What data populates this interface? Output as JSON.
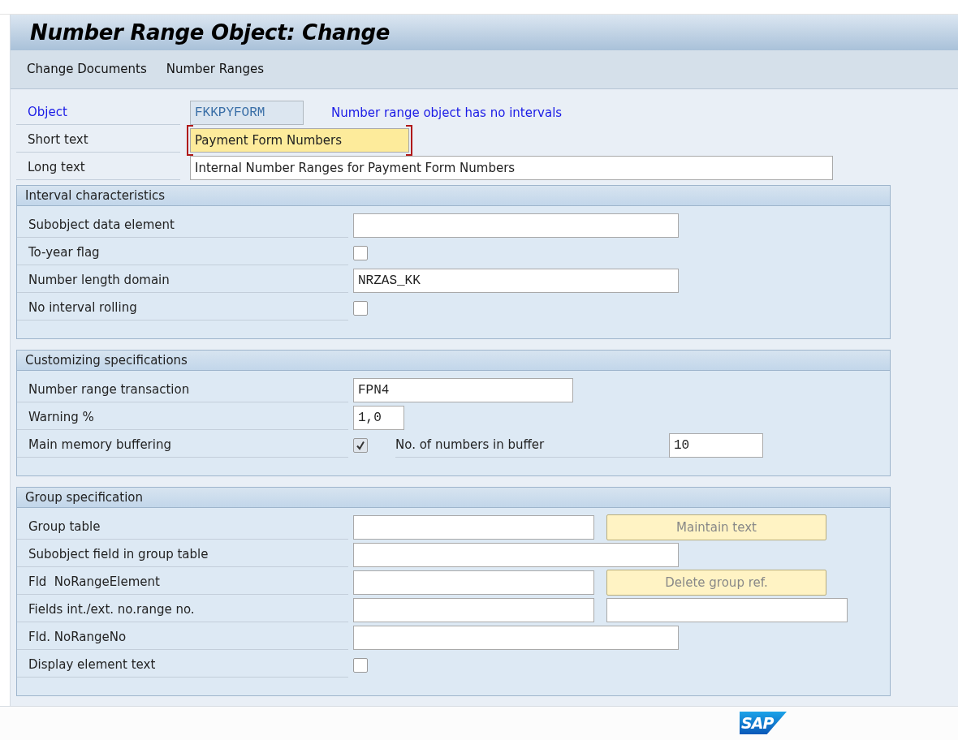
{
  "window": {
    "title": "Number Range Object: Change"
  },
  "toolbar": [
    {
      "label": "Change Documents"
    },
    {
      "label": "Number Ranges"
    }
  ],
  "header": {
    "object": {
      "label": "Object",
      "value": "FKKPYFORM",
      "message": "Number range object has no intervals"
    },
    "short_text": {
      "label": "Short text",
      "value": "Payment Form Numbers",
      "focused": true
    },
    "long_text": {
      "label": "Long text",
      "value": "Internal Number Ranges for Payment Form Numbers"
    }
  },
  "groups": [
    {
      "title": "Interval characteristics",
      "rows": [
        {
          "kind": "field",
          "label": "Subobject data element"
        },
        {
          "kind": "checkbox",
          "label": "To-year flag",
          "checked": false
        },
        {
          "kind": "field",
          "label": "Number length domain",
          "value": "NRZAS_KK"
        },
        {
          "kind": "checkbox",
          "label": "No interval rolling",
          "checked": false
        }
      ]
    },
    {
      "title": "Customizing specifications",
      "rows": [
        {
          "kind": "field",
          "label": "Number range transaction",
          "value": "FPN4"
        },
        {
          "kind": "field",
          "label": "Warning %",
          "value": "1,0"
        },
        {
          "kind": "checkbox_field",
          "label": "Main memory buffering",
          "checked": true,
          "label2": "No. of numbers in buffer",
          "value2": "10"
        }
      ]
    },
    {
      "title": "Group specification",
      "rows": [
        {
          "kind": "field_button",
          "label": "Group table",
          "button": {
            "label": "Maintain text",
            "disabled": true
          }
        },
        {
          "kind": "field",
          "label": "Subobject field in group table"
        },
        {
          "kind": "field_button",
          "label": "Fld  NoRangeElement",
          "button": {
            "label": "Delete group ref.",
            "disabled": true
          }
        },
        {
          "kind": "field_pair",
          "label": "Fields int./ext. no.range no."
        },
        {
          "kind": "field",
          "label": "Fld. NoRangeNo"
        },
        {
          "kind": "checkbox",
          "label": "Display element text",
          "checked": false
        }
      ]
    }
  ],
  "logo": "SAP"
}
